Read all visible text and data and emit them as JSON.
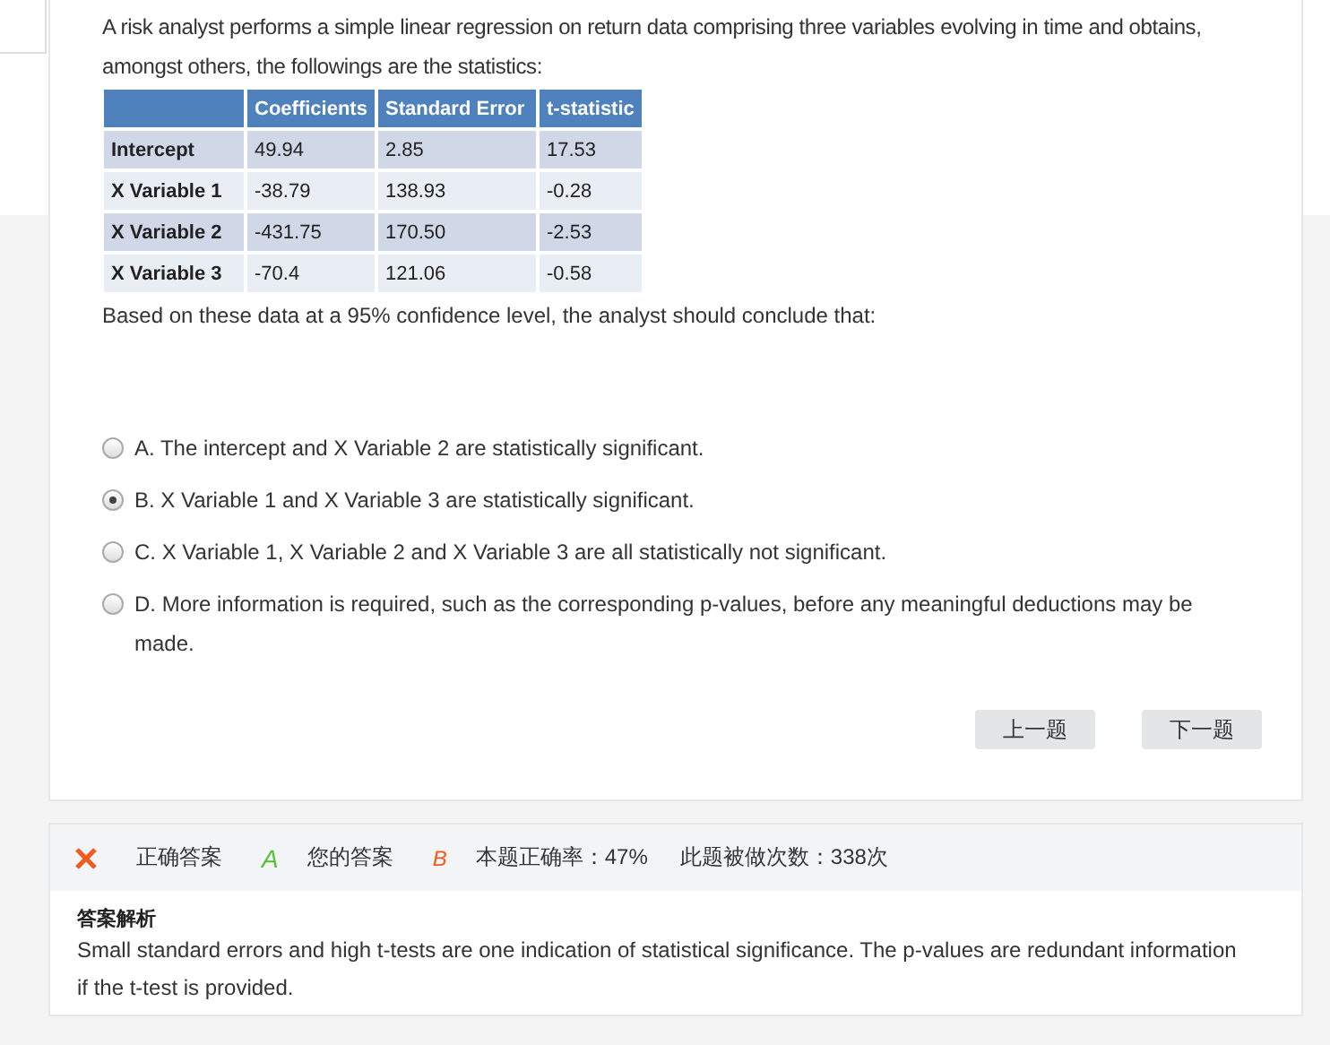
{
  "question": {
    "text": "A risk analyst performs a simple linear regression on return data comprising three variables evolving in time and obtains, amongst others, the followings are the statistics:",
    "table": {
      "columns": [
        "",
        "Coefficients",
        "Standard Error",
        "t-statistic"
      ],
      "rows": [
        [
          "Intercept",
          "49.94",
          "2.85",
          "17.53"
        ],
        [
          "X Variable 1",
          "-38.79",
          "138.93",
          "-0.28"
        ],
        [
          "X Variable 2",
          "-431.75",
          "170.50",
          "-2.53"
        ],
        [
          "X Variable 3",
          "-70.4",
          "121.06",
          "-0.58"
        ]
      ]
    },
    "prompt": "Based on these data at a 95% confidence level, the analyst should conclude that:"
  },
  "options": [
    {
      "label": "A. The intercept and X Variable 2 are statistically significant.",
      "selected": false
    },
    {
      "label": "B. X Variable 1 and X Variable 3 are statistically significant.",
      "selected": true
    },
    {
      "label": "C. X Variable 1, X Variable 2 and X Variable 3 are all statistically not significant.",
      "selected": false
    },
    {
      "label": "D. More information is required, such as the corresponding p-values, before any meaningful deductions may be made.",
      "selected": false
    }
  ],
  "buttons": [
    "上一题",
    "下一题"
  ],
  "result": {
    "correct_label": "正确答案",
    "correct_answer": "A",
    "your_label": "您的答案",
    "your_answer": "B",
    "accuracy": "本题正确率：47%",
    "attempts": "此题被做次数：338次"
  },
  "explanation": {
    "title": "答案解析",
    "text": "Small standard errors and high t-tests are one indication of statistical significance. The p-values are redundant information if the t-test is provided."
  }
}
